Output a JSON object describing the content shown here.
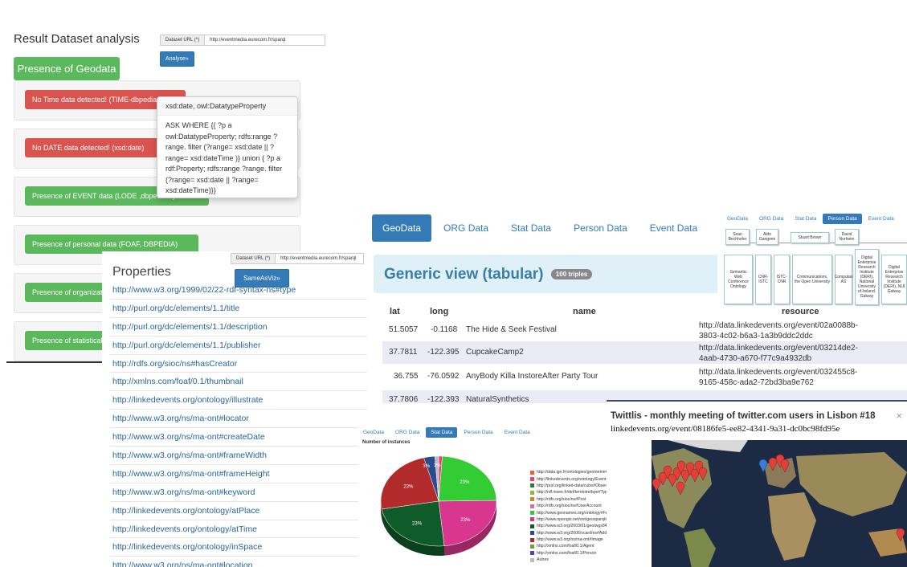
{
  "analysis": {
    "title": "Result Dataset analysis",
    "url_label": "Dataset URL (*)",
    "url_value": "http://eventmedia.eurecom.fr/sparql",
    "analyse_button": "Analyse»",
    "geodata_button": "Presence of Geodata",
    "alerts": [
      {
        "text": "No Time data detected! (TIME-dbpedia...)",
        "kind": "red"
      },
      {
        "text": "No DATE data detected! (xsd:date)",
        "kind": "red"
      },
      {
        "text": "Presence of EVENT data (LODE ,dbpedia...)",
        "kind": "green"
      },
      {
        "text": "Presence of personal data (FOAF, DBPEDIA)",
        "kind": "green"
      },
      {
        "text": "Presence of organizat...",
        "kind": "green"
      },
      {
        "text": "Presence of statistical...",
        "kind": "green"
      }
    ],
    "popover": {
      "title": "xsd:date, owl:DatatypeProperty",
      "body": "ASK WHERE {{ ?p a owl:DatatypeProperty; rdfs:range ?range. filter (?range= xsd:date || ?range= xsd:dateTime )} union { ?p a rdf:Property; rdfs:range ?range. filter (?range= xsd:date || ?range= xsd:dateTime)}}"
    }
  },
  "properties": {
    "title": "Properties",
    "url_label": "Dataset URL (*)",
    "url_value": "http://eventmedia.eurecom.fr/sparql",
    "button": "SameAsViz»",
    "items": [
      "http://www.w3.org/1999/02/22-rdf-syntax-ns#type",
      "http://purl.org/dc/elements/1.1/title",
      "http://purl.org/dc/elements/1.1/description",
      "http://purl.org/dc/elements/1.1/publisher",
      "http://rdfs.org/sioc/ns#hasCreator",
      "http://xmlns.com/foaf/0.1/thumbnail",
      "http://linkedevents.org/ontology/illustrate",
      "http://www.w3.org/ns/ma-ont#locator",
      "http://www.w3.org/ns/ma-ont#createDate",
      "http://www.w3.org/ns/ma-ont#frameWidth",
      "http://www.w3.org/ns/ma-ont#frameHeight",
      "http://www.w3.org/ns/ma-ont#keyword",
      "http://linkedevents.org/ontology/atPlace",
      "http://linkedevents.org/ontology/atTime",
      "http://linkedevents.org/ontology/inSpace",
      "http://www.w3.org/ns/ma-ont#location"
    ]
  },
  "generic": {
    "tabs": [
      "GeoData",
      "ORG Data",
      "Stat Data",
      "Person Data",
      "Event Data"
    ],
    "title": "Generic view (tabular)",
    "badge": "100 triples",
    "headers": {
      "lat": "lat",
      "long": "long",
      "name": "name",
      "resource": "resource"
    },
    "rows": [
      {
        "lat": "51.5057",
        "long": "-0.1168",
        "name": "The Hide & Seek Festival",
        "res1": "http://data.linkedevents.org/event/02a0088b-",
        "res2": "3803-4c02-b6a3-1a3b9ddc2ddc"
      },
      {
        "lat": "37.7811",
        "long": "-122.395",
        "name": "CupcakeCamp2",
        "res1": "http://data.linkedevents.org/event/03214de2-",
        "res2": "4aab-4730-a670-f77c9a4932db"
      },
      {
        "lat": "36.755",
        "long": "-76.0592",
        "name": "AnyBody Killa InstoreAfter Party Tour",
        "res1": "http://data.linkedevents.org/event/032455c8-",
        "res2": "9165-458c-ada2-72bd3ba9e762"
      },
      {
        "lat": "37.7806",
        "long": "-122.393",
        "name": "NaturalSynthetics",
        "res1": "http://data.linkedevents.org/event/034021",
        "res2": ""
      }
    ]
  },
  "orgchart": {
    "tabs": [
      "GeoData",
      "ORG Data",
      "Stat Data",
      "Person Data",
      "Event Data"
    ],
    "people": [
      "Sean Bechhofer",
      "Aldo Gangemi",
      "Stuart Brown",
      "David Norheim"
    ],
    "orgs": [
      "Semantic Web Conference Ontology",
      "CNR-ISTC",
      "ISTC-CNR",
      "Communications, the Open University",
      "Computas AS",
      "Digital Enterprise Research Institute (DERI), National University of Ireland, Galway",
      "Digital Enterprise Research Institute (DERI), NUI Galway"
    ]
  },
  "piechart": {
    "tabs": [
      "GeoData",
      "ORG Data",
      "Stat Data",
      "Person Data",
      "Event Data"
    ],
    "title": "Number of instances",
    "labels": [
      "23%",
      "23%",
      "23%",
      "23%",
      "3%",
      "1%"
    ]
  },
  "chart_data": {
    "type": "pie",
    "title": "Number of instances",
    "categories": [
      "http://data.ign.fr/ontologies/geometrie#Point",
      "http://linkedevents.org/ontology/Event",
      "http://purl.org/linked-data/cube#Observation",
      "http://rdf.insee.fr/def/territoire/bpe#TypeEquipement",
      "http://rdfs.org/sioc/ns#Post",
      "http://rdfs.org/sioc/ns#UserAccount",
      "http://www.geonames.org/ontology#Feature",
      "http://www.opengis.net/ont/geosparql#Geometry",
      "http://www.w3.org/2003/01/geo/wgs84_pos#Point",
      "http://www.w3.org/2006/vcard/ns#Address",
      "http://www.w3.org/ns/ma-ont#Image",
      "http://xmlns.com/foaf/0.1/Agent",
      "http://xmlns.com/foaf/0.1/Person",
      "Autres"
    ],
    "colors": [
      "#e8612c",
      "#e8407a",
      "#2f7a3a",
      "#8fb83c",
      "#cc8a2e",
      "#e36a9e",
      "#33cc33",
      "#d9378f",
      "#0f5c2a",
      "#2a4b8d",
      "#b22b2b",
      "#7a9a3a",
      "#4a4aa0",
      "#bbbbbb"
    ],
    "slices": [
      {
        "name": "http://linkedevents.org/ontology/Event",
        "value": 1,
        "color": "#e8407a"
      },
      {
        "name": "http://www.geonames.org/ontology#Feature",
        "value": 23,
        "color": "#33cc33"
      },
      {
        "name": "http://www.opengis.net/ont/geosparql#Geometry",
        "value": 23,
        "color": "#d9378f"
      },
      {
        "name": "http://www.w3.org/2003/01/geo/wgs84_pos#Point",
        "value": 23,
        "color": "#0f5c2a"
      },
      {
        "name": "http://www.w3.org/ns/ma-ont#Image",
        "value": 23,
        "color": "#b22b2b"
      },
      {
        "name": "http://www.w3.org/2006/vcard/ns#Address",
        "value": 3,
        "color": "#2a4b8d"
      },
      {
        "name": "Autres",
        "value": 1,
        "color": "#bbbbbb"
      }
    ]
  },
  "map_popup": {
    "title": "Twittlis - monthly meeting of twitter.com users in Lisbon #18",
    "link": "linkedevents.org/event/08186fe5-ee82-4341-9a31-dc0bc98fd95e",
    "close": "×"
  }
}
